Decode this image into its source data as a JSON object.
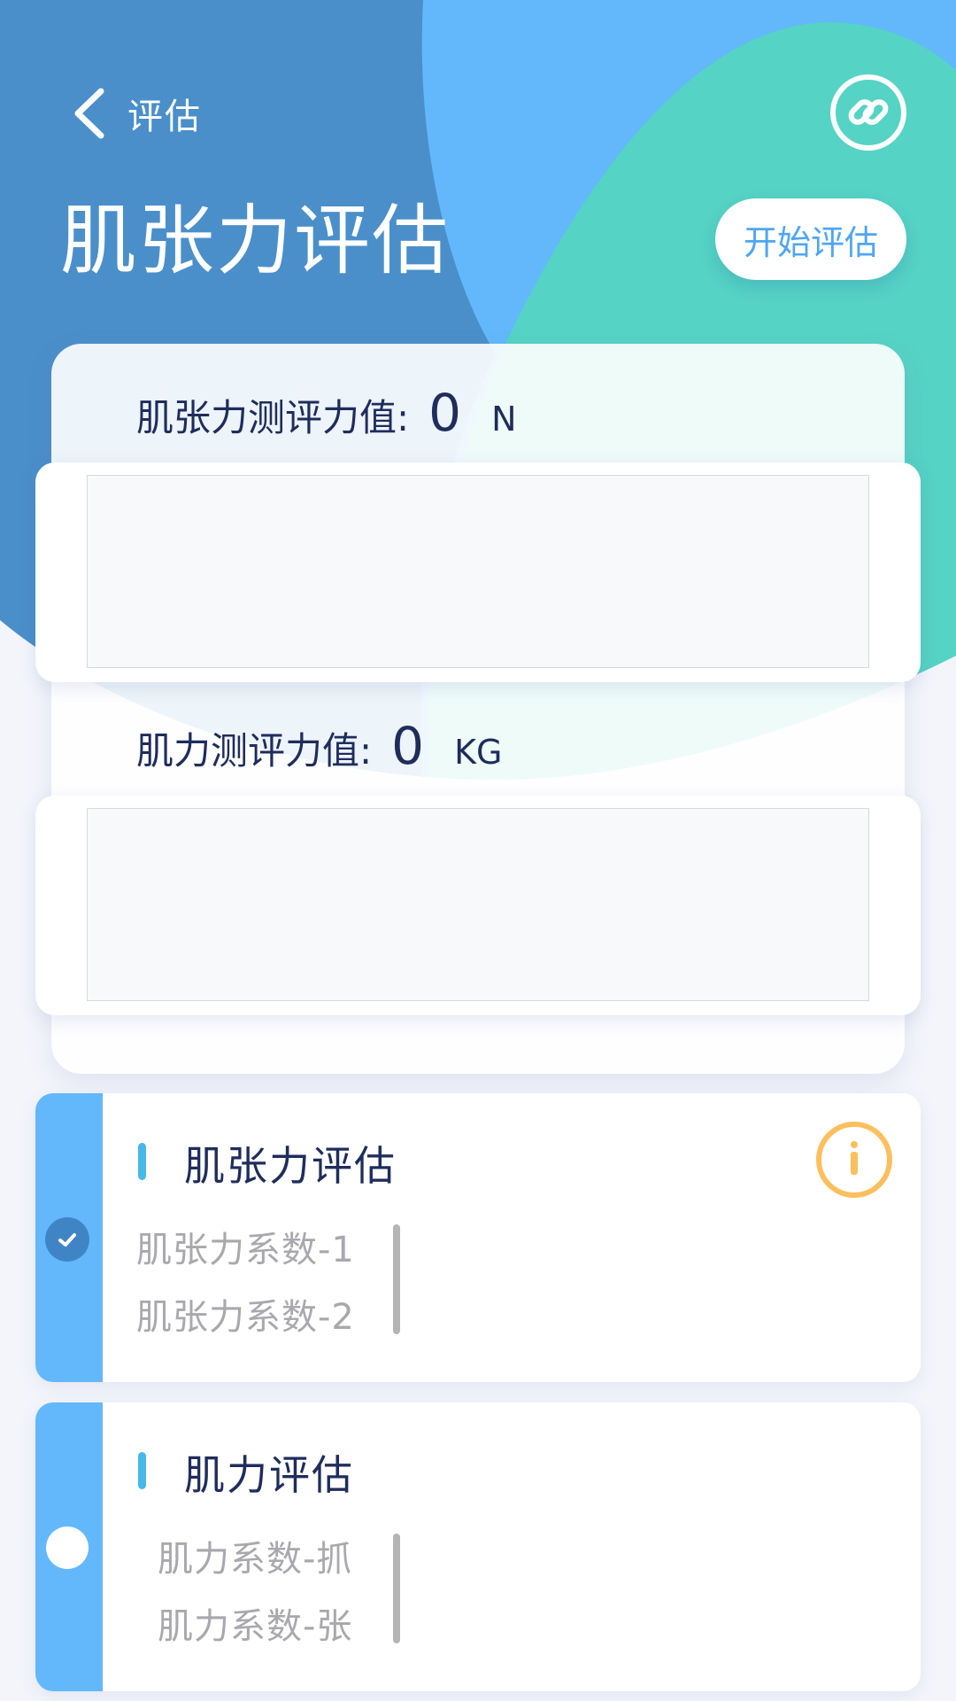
{
  "header": {
    "back_label": "评估",
    "title": "肌张力评估",
    "start_button": "开始评估"
  },
  "measurements": {
    "tension": {
      "label": "肌张力测评力值:",
      "value": "0",
      "unit": "N"
    },
    "strength": {
      "label": "肌力测评力值:",
      "value": "0",
      "unit": "KG"
    }
  },
  "evaluations": [
    {
      "title": "肌张力评估",
      "selected": true,
      "coefficients": [
        "肌张力系数-1",
        "肌张力系数-2"
      ]
    },
    {
      "title": "肌力评估",
      "selected": false,
      "coefficients": [
        "肌力系数-抓",
        "肌力系数-张"
      ]
    }
  ],
  "icons": {
    "back": "chevron-left-icon",
    "link": "link-icon",
    "check": "check-icon",
    "info": "info-icon"
  },
  "colors": {
    "primary_blue": "#4a90c8",
    "light_blue": "#63b8fb",
    "teal": "#56d3c5",
    "info_orange": "#fcbf5d",
    "text_dark": "#1f2d5c"
  }
}
